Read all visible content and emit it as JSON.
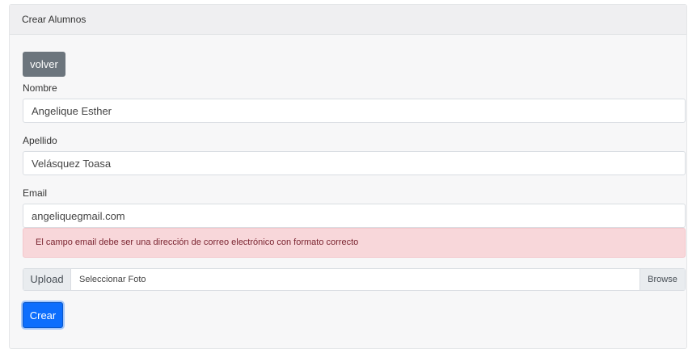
{
  "header": {
    "title": "Crear Alumnos"
  },
  "buttons": {
    "back_label": "volver",
    "create_label": "Crear"
  },
  "form": {
    "nombre": {
      "label": "Nombre",
      "value": "Angelique Esther"
    },
    "apellido": {
      "label": "Apellido",
      "value": "Velásquez Toasa"
    },
    "email": {
      "label": "Email",
      "value": "angeliquegmail.com"
    },
    "email_error": "El campo email debe ser una dirección de correo electrónico con formato correcto",
    "upload": {
      "label": "Upload",
      "placeholder": "Seleccionar Foto",
      "browse_label": "Browse"
    }
  },
  "colors": {
    "primary": "#0d6efd",
    "secondary": "#6c757d",
    "danger_bg": "#f8d7da"
  }
}
